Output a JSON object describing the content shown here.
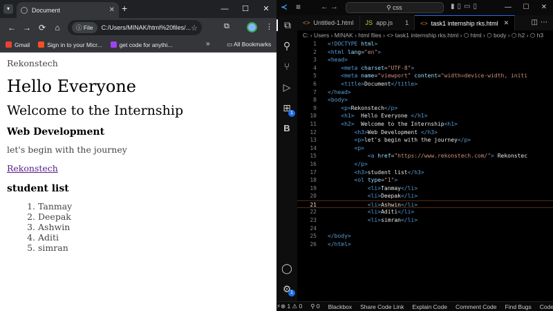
{
  "chrome": {
    "tab_title": "Document",
    "tab_close": "✕",
    "new_tab": "+",
    "window_controls": {
      "minimize": "—",
      "maximize": "☐",
      "close": "✕"
    },
    "nav": {
      "back": "←",
      "forward": "→",
      "reload": "⟳",
      "home": "⌂"
    },
    "address_chip": "ⓘ File",
    "address_url": "C:/Users/MINAK/html%20files/...",
    "bookmarks": [
      {
        "label": "Gmail",
        "color": "#ea4335"
      },
      {
        "label": "Sign in to your Micr...",
        "color": "#f25022"
      },
      {
        "label": "get code for anythi...",
        "color": "#a142f4"
      }
    ],
    "bookmarks_more": "»",
    "all_bookmarks": "All Bookmarks",
    "page": {
      "p1": "Rekonstech",
      "h1": "Hello Everyone",
      "h2": "Welcome to the Internship",
      "h3a": "Web Development",
      "p2": "let's begin with the journey",
      "link": "Rekonstech",
      "h3b": "student list",
      "list": [
        "Tanmay",
        "Deepak",
        "Ashwin",
        "Aditi",
        "simran"
      ]
    }
  },
  "vscode": {
    "search_text": "css",
    "tabs": [
      {
        "label": "Untitled-1.html",
        "icon": "<>",
        "type": "html"
      },
      {
        "label": "app.js",
        "icon": "JS",
        "type": "js",
        "badge": "1"
      },
      {
        "label": "task1 internship rks.html",
        "icon": "<>",
        "type": "html",
        "active": true
      }
    ],
    "breadcrumb": "C: › Users › MINAK › html files › <> task1 internship rks.html › ⬡ html › ⬡ body › ⬡ h2 › ⬡ h3",
    "activity_badges": {
      "extensions": "1",
      "settings": "1"
    },
    "activity_b_label": "B",
    "current_line": 21,
    "status": {
      "errors": "⊗ 1 ⚠ 0",
      "ports": "⚲ 0",
      "items": [
        "Blackbox",
        "Share Code Link",
        "Explain Code",
        "Comment Code",
        "Find Bugs",
        "Code Chat"
      ]
    }
  }
}
